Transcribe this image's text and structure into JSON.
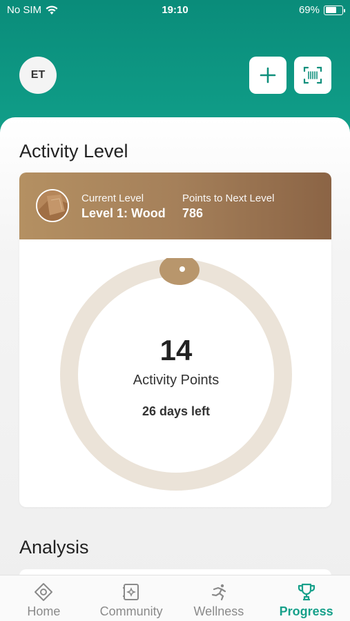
{
  "status_bar": {
    "carrier": "No SIM",
    "time": "19:10",
    "battery": "69%",
    "battery_level": 0.69
  },
  "header": {
    "avatar_initials": "ET",
    "add_icon": "plus-icon",
    "scan_icon": "barcode-scan-icon"
  },
  "activity": {
    "title": "Activity Level",
    "current_level_label": "Current Level",
    "current_level_value": "Level 1: Wood",
    "next_level_label": "Points to Next Level",
    "next_level_value": "786",
    "points": "14",
    "points_label": "Activity Points",
    "days_left": "26 days left",
    "progress_fraction": 0.0
  },
  "analysis": {
    "title": "Analysis"
  },
  "tabs": [
    {
      "label": "Home",
      "icon": "home-icon",
      "active": false
    },
    {
      "label": "Community",
      "icon": "community-icon",
      "active": false
    },
    {
      "label": "Wellness",
      "icon": "wellness-icon",
      "active": false
    },
    {
      "label": "Progress",
      "icon": "trophy-icon",
      "active": true
    }
  ],
  "colors": {
    "accent": "#17a08a",
    "header": "#0f9b86",
    "wood": "#a5805a",
    "ring": "#ebe3d8"
  }
}
